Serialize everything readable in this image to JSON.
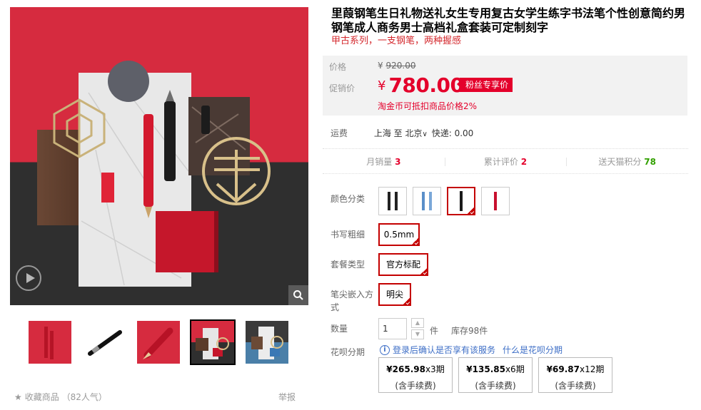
{
  "gallery": {
    "main_image_alt": "",
    "thumbnails": [
      {
        "name": "thumb-red-pen-box"
      },
      {
        "name": "thumb-black-pen"
      },
      {
        "name": "thumb-red-pen-nib"
      },
      {
        "name": "thumb-flatlay-red",
        "active": true
      },
      {
        "name": "thumb-flatlay-blue"
      }
    ],
    "favorite_label": "收藏商品",
    "favorite_count": "（82人气）",
    "report_label": "举报"
  },
  "product": {
    "title": "里葭钢笔生日礼物送礼女生专用复古女学生练字书法笔个性创意简约男钢笔成人商务男士高档礼盒套装可定制刻字",
    "subtitle": "甲古系列，一支钢笔，两种握感"
  },
  "price": {
    "original_label": "价格",
    "original_currency": "¥",
    "original_value": "920.00",
    "promo_label": "促销价",
    "promo_currency": "¥",
    "promo_value": "780.00",
    "fan_tag": "粉丝专享价",
    "taojin_note": "淘金币可抵扣商品价格2%"
  },
  "shipping": {
    "label": "运费",
    "from": "上海",
    "to_word": "至",
    "to": "北京",
    "method": "快递:",
    "fee": "0.00"
  },
  "stats": {
    "monthly_sales_label": "月销量",
    "monthly_sales": "3",
    "reviews_label": "累计评价",
    "reviews": "2",
    "points_label": "送天猫积分",
    "points": "78"
  },
  "options": {
    "color_label": "颜色分类",
    "colors": [
      {
        "name": "black-pen-1",
        "color": "#222222"
      },
      {
        "name": "blue-pen",
        "color": "#5a8fc9"
      },
      {
        "name": "black-pen-2",
        "color": "#1a1a1a",
        "selected": true
      },
      {
        "name": "red-pen",
        "color": "#c8102e"
      }
    ],
    "nib_label": "书写粗细",
    "nib_value": "0.5mm",
    "package_label": "套餐类型",
    "package_value": "官方标配",
    "nib_embed_label": "笔尖嵌入方式",
    "nib_embed_value": "明尖"
  },
  "quantity": {
    "label": "数量",
    "value": "1",
    "unit": "件",
    "stock": "库存98件"
  },
  "huabei": {
    "label": "花呗分期",
    "info_icon": "i",
    "notice": "登录后确认是否享有该服务",
    "link": "什么是花呗分期",
    "plans": [
      {
        "amount": "¥265.98",
        "periods": "x3期",
        "fee": "(含手续费)"
      },
      {
        "amount": "¥135.85",
        "periods": "x6期",
        "fee": "(含手续费)"
      },
      {
        "amount": "¥69.87",
        "periods": "x12期",
        "fee": "(含手续费)"
      }
    ]
  },
  "colors": {
    "accent": "#e4002b",
    "selection": "#c40000",
    "link": "#3d6ec6",
    "points_green": "#32a000"
  }
}
